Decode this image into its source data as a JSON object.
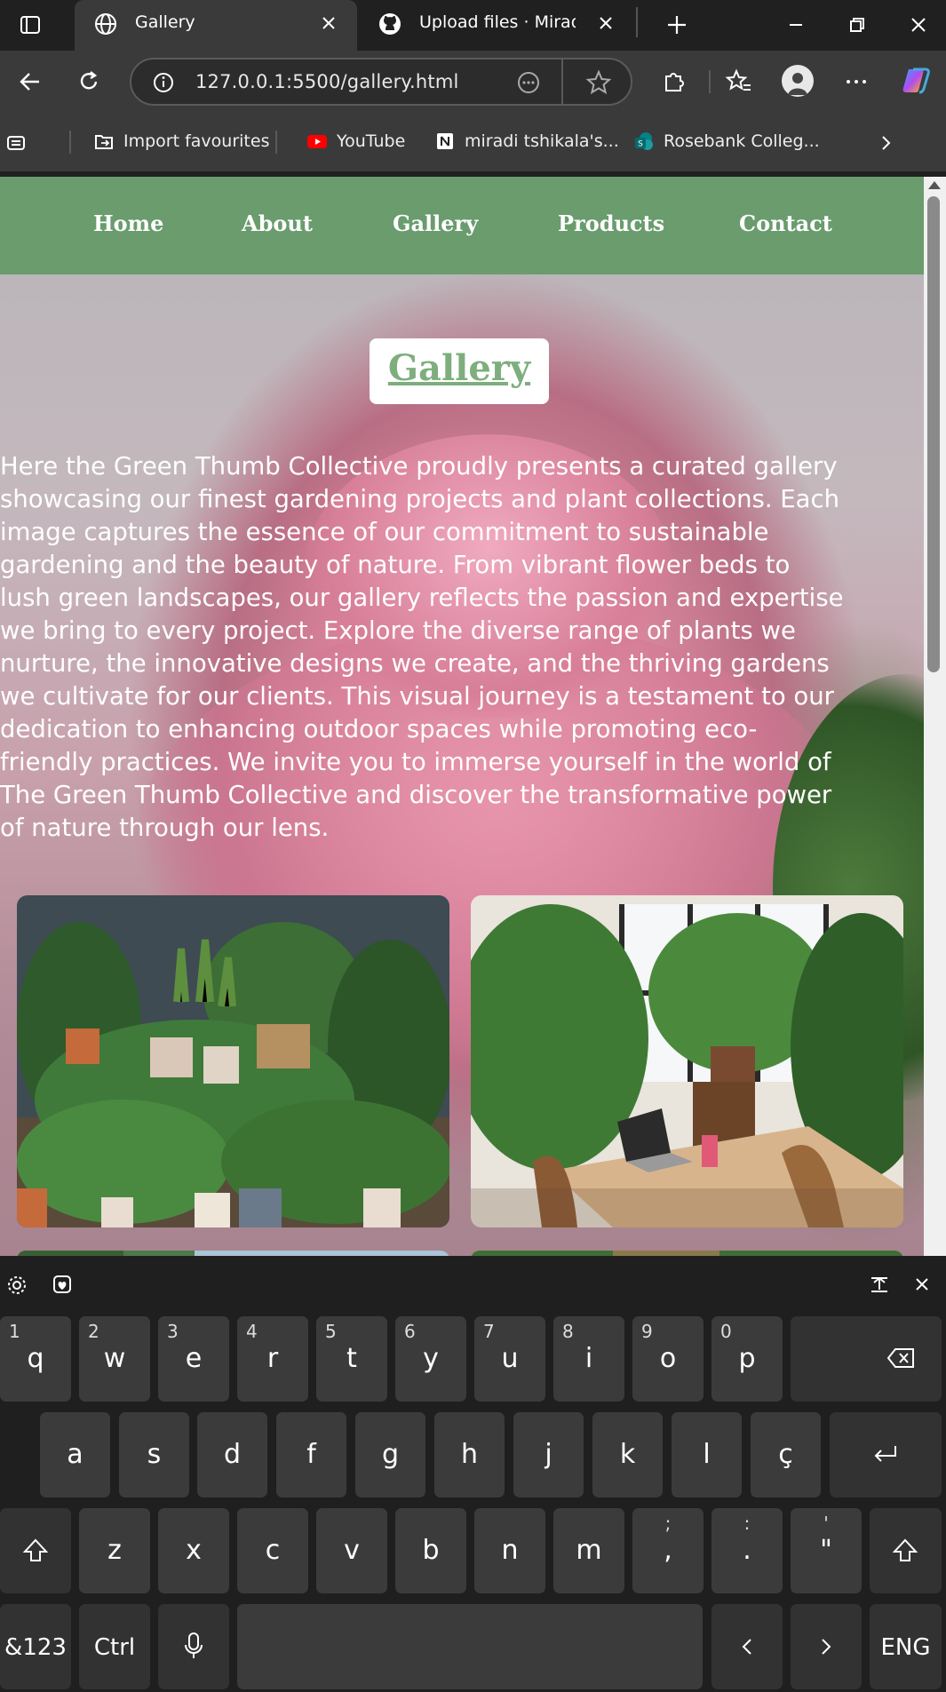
{
  "browser": {
    "tabs": [
      {
        "title": "Gallery",
        "icon": "globe-icon",
        "active": true
      },
      {
        "title": "Upload files · Miradi-Mrkn",
        "icon": "github-icon",
        "active": false
      }
    ],
    "url": "127.0.0.1:5500/gallery.html",
    "bookmarks": [
      {
        "label": "Import favourites",
        "icon": "import-icon"
      },
      {
        "label": "YouTube",
        "icon": "youtube-icon"
      },
      {
        "label": "miradi tshikala's...",
        "icon": "notion-icon"
      },
      {
        "label": "Rosebank Colleg...",
        "icon": "sharepoint-icon"
      }
    ]
  },
  "page": {
    "nav": [
      "Home",
      "About",
      "Gallery",
      "Products",
      "Contact"
    ],
    "heading": "Gallery",
    "intro_lines": [
      "Here the Green Thumb Collective proudly presents a curated gallery",
      "showcasing our finest gardening projects and plant collections. Each",
      "image captures the essence of our commitment to sustainable",
      "gardening and the beauty of nature. From vibrant flower beds to",
      "lush green landscapes, our gallery reflects the passion and expertise",
      "we bring to every project. Explore the diverse range of plants we",
      "nurture, the innovative designs we create, and the thriving gardens",
      "we cultivate for our clients. This visual journey is a testament to our",
      "dedication to enhancing outdoor spaces while promoting eco-",
      "friendly practices. We invite you to immerse yourself in the world of",
      "The Green Thumb Collective and discover the transformative power",
      "of nature through our lens."
    ],
    "colors": {
      "nav_bg": "#6a9c6e",
      "heading": "#7eae7e"
    }
  },
  "keyboard": {
    "row1": [
      [
        "q",
        "1"
      ],
      [
        "w",
        "2"
      ],
      [
        "e",
        "3"
      ],
      [
        "r",
        "4"
      ],
      [
        "t",
        "5"
      ],
      [
        "y",
        "6"
      ],
      [
        "u",
        "7"
      ],
      [
        "i",
        "8"
      ],
      [
        "o",
        "9"
      ],
      [
        "p",
        "0"
      ]
    ],
    "row2": [
      "a",
      "s",
      "d",
      "f",
      "g",
      "h",
      "j",
      "k",
      "l",
      "ç"
    ],
    "row3": [
      [
        "z",
        ""
      ],
      [
        "x",
        ""
      ],
      [
        "c",
        ""
      ],
      [
        "v",
        ""
      ],
      [
        "b",
        ""
      ],
      [
        "n",
        ""
      ],
      [
        "m",
        ""
      ],
      [
        ",",
        ";"
      ],
      [
        ".",
        ":"
      ],
      [
        "\"",
        "'"
      ]
    ],
    "symbols_key": "&123",
    "ctrl_key": "Ctrl",
    "lang_key": "ENG"
  }
}
